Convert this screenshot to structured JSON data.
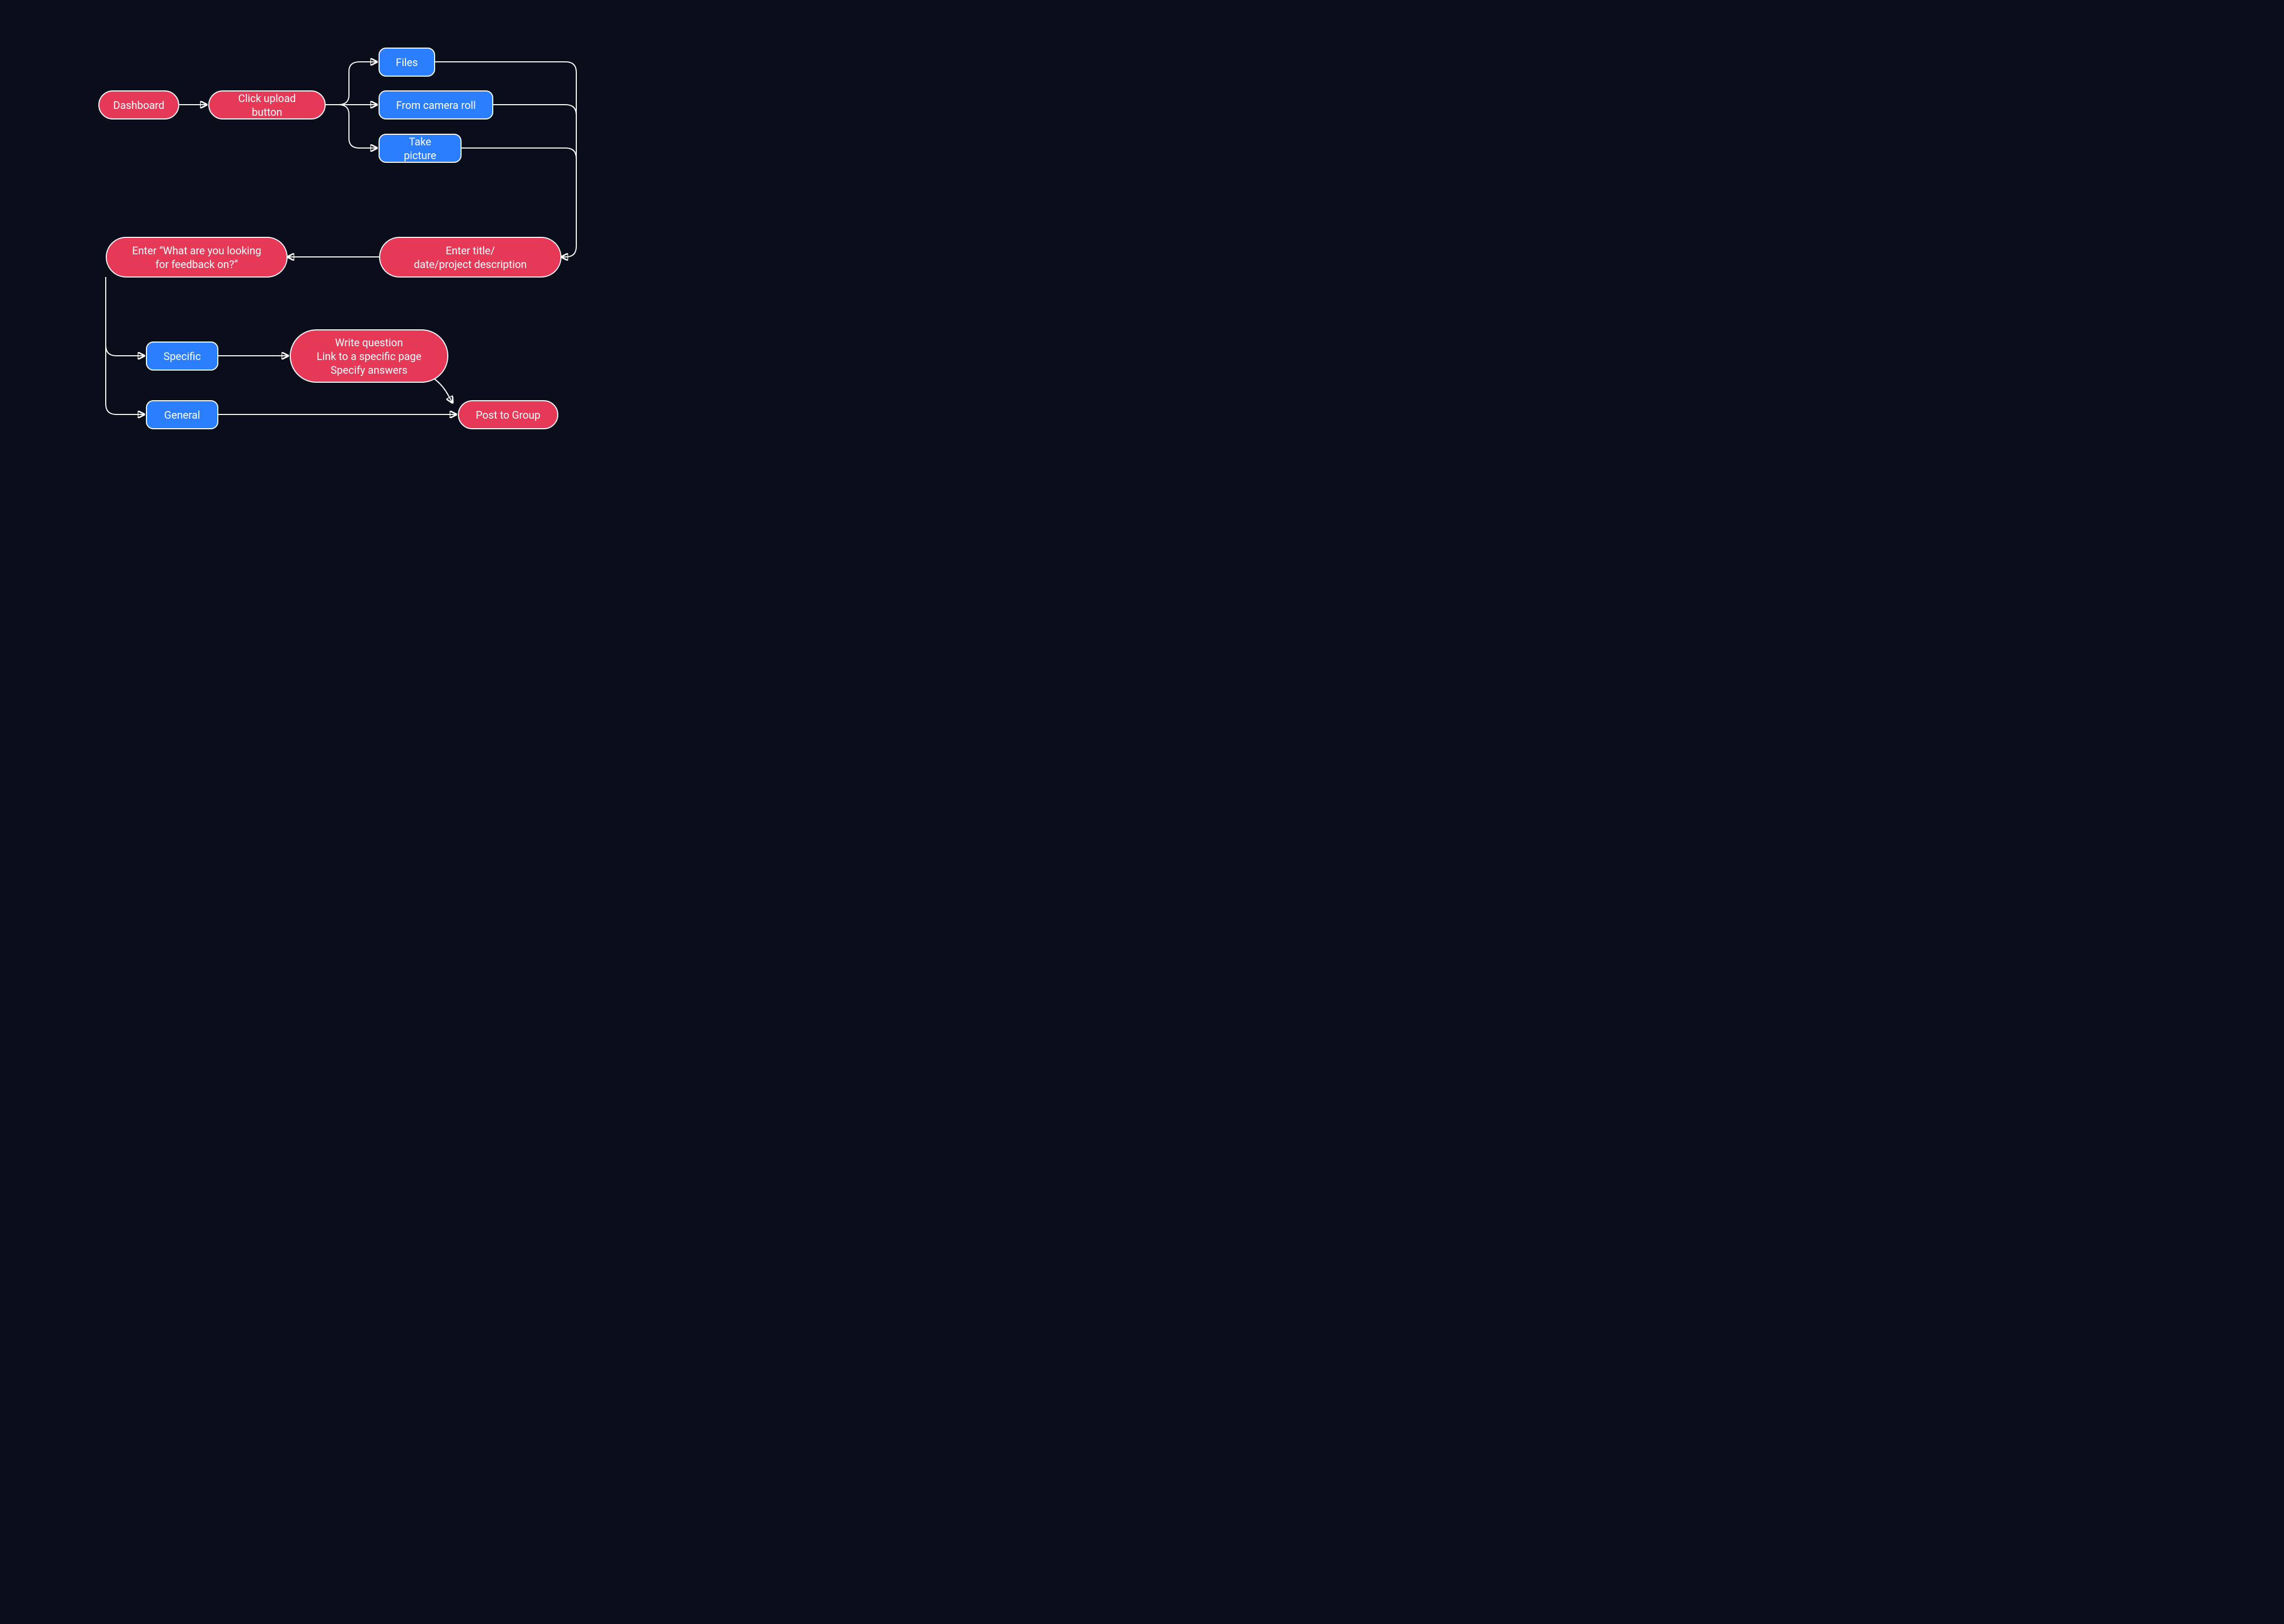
{
  "nodes": {
    "dashboard": "Dashboard",
    "click_upload": "Click upload button",
    "files": "Files",
    "camera_roll": "From camera roll",
    "take_picture": "Take picture",
    "enter_title": "Enter title/\ndate/project description",
    "enter_feedback": "Enter “What are you looking\nfor feedback on?”",
    "specific": "Specific",
    "general": "General",
    "write_question": "Write question\nLink to a specific page\nSpecify answers",
    "post_to_group": "Post to Group"
  },
  "colors": {
    "bg": "#0a0e1a",
    "red": "#e63957",
    "blue": "#2b7fff",
    "edge": "#fff"
  }
}
